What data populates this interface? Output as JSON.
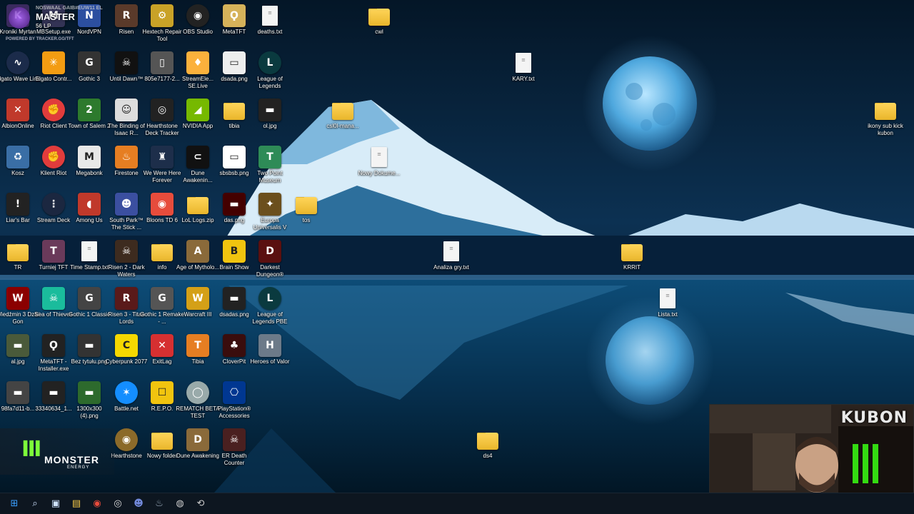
{
  "overlay": {
    "player": "NOSWAAL GAIB#EUW11 EL",
    "rank": "MASTER",
    "lp": "56 LP",
    "powered_by": "POWERED BY TRACKER.GG/TFT"
  },
  "icons": [
    {
      "label": "Kroniki Myrtan",
      "kind": "tile",
      "bg": "#3a2a5e",
      "sym": "K"
    },
    {
      "label": "MBSetup.exe",
      "kind": "tile",
      "bg": "#335",
      "sym": "M"
    },
    {
      "label": "NordVPN",
      "kind": "tile",
      "bg": "#2c4fa0",
      "sym": "N"
    },
    {
      "label": "Risen",
      "kind": "tile",
      "bg": "#5a3a2a",
      "sym": "R"
    },
    {
      "label": "Hextech Repair Tool",
      "kind": "tile",
      "bg": "#c9a227",
      "sym": "⚙"
    },
    {
      "label": "OBS Studio",
      "kind": "round",
      "bg": "#222",
      "sym": "◉"
    },
    {
      "label": "MetaTFT",
      "kind": "tile",
      "bg": "#d6b25a",
      "sym": "Ϙ"
    },
    {
      "label": "deaths.txt",
      "kind": "file",
      "bg": "#f4f4f4",
      "sym": "≡"
    },
    {
      "label": "cwl",
      "kind": "folder",
      "bg": "#ffd55a",
      "sym": ""
    },
    {
      "label": "Elgato Wave Link",
      "kind": "round",
      "bg": "#1b2b4a",
      "sym": "∿"
    },
    {
      "label": "Elgato Contr...",
      "kind": "tile",
      "bg": "#f39c12",
      "sym": "✳"
    },
    {
      "label": "Gothic 3",
      "kind": "tile",
      "bg": "#333",
      "sym": "G"
    },
    {
      "label": "Until Dawn™",
      "kind": "tile",
      "bg": "#111",
      "sym": "☠"
    },
    {
      "label": "805e7177-2...",
      "kind": "tile",
      "bg": "#555",
      "sym": "▯"
    },
    {
      "label": "StreamEle... SE.Live",
      "kind": "tile",
      "bg": "#fbb13c",
      "sym": "♦"
    },
    {
      "label": "dsada.png",
      "kind": "tile",
      "bg": "#eee",
      "sym": "▭"
    },
    {
      "label": "League of Legends",
      "kind": "round",
      "bg": "#0a3a3f",
      "sym": "L"
    },
    {
      "label": "KARY.txt",
      "kind": "file",
      "bg": "#f4f4f4",
      "sym": "≡"
    },
    {
      "label": "AlbionOnline",
      "kind": "tile",
      "bg": "#c0392b",
      "sym": "✕"
    },
    {
      "label": "Riot Client",
      "kind": "round",
      "bg": "#e13c3c",
      "sym": "✊"
    },
    {
      "label": "Town of Salem 2",
      "kind": "tile",
      "bg": "#2d7a2d",
      "sym": "2"
    },
    {
      "label": "The Binding of Isaac R...",
      "kind": "tile",
      "bg": "#ddd",
      "sym": "☺"
    },
    {
      "label": "Hearthstone Deck Tracker",
      "kind": "tile",
      "bg": "#222",
      "sym": "◎"
    },
    {
      "label": "NVIDIA App",
      "kind": "tile",
      "bg": "#76b900",
      "sym": "◢"
    },
    {
      "label": "tibia",
      "kind": "folder",
      "bg": "#ffd55a",
      "sym": ""
    },
    {
      "label": "ol.jpg",
      "kind": "tile",
      "bg": "#222",
      "sym": "▬"
    },
    {
      "label": "csl0l-mana...",
      "kind": "folder",
      "bg": "#ffd55a",
      "sym": ""
    },
    {
      "label": "ikony sub kick kubon",
      "kind": "folder",
      "bg": "#ffd55a",
      "sym": ""
    },
    {
      "label": "Kosz",
      "kind": "tile",
      "bg": "#3a6ea5",
      "sym": "♻"
    },
    {
      "label": "Klient Riot",
      "kind": "round",
      "bg": "#e13c3c",
      "sym": "✊"
    },
    {
      "label": "Megabonk",
      "kind": "tile",
      "bg": "#e8e8e8",
      "sym": "M"
    },
    {
      "label": "Firestone",
      "kind": "tile",
      "bg": "#e67e22",
      "sym": "♨"
    },
    {
      "label": "We Were Here Forever",
      "kind": "tile",
      "bg": "#1d2e4a",
      "sym": "♜"
    },
    {
      "label": "Dune Awakenin...",
      "kind": "tile",
      "bg": "#111",
      "sym": "⊂"
    },
    {
      "label": "sbsbsb.png",
      "kind": "tile",
      "bg": "#fff",
      "sym": "▭"
    },
    {
      "label": "Two Point Museum",
      "kind": "tile",
      "bg": "#2e8b57",
      "sym": "T"
    },
    {
      "label": "Nowy Dokume...",
      "kind": "file",
      "bg": "#f4f4f4",
      "sym": "≡"
    },
    {
      "label": "Liar's Bar",
      "kind": "tile",
      "bg": "#222",
      "sym": "!"
    },
    {
      "label": "Stream Deck",
      "kind": "round",
      "bg": "#1b2740",
      "sym": "⋮"
    },
    {
      "label": "Among Us",
      "kind": "tile",
      "bg": "#c0392b",
      "sym": "◖"
    },
    {
      "label": "South Park™ The Stick ...",
      "kind": "tile",
      "bg": "#3b4fa0",
      "sym": "☻"
    },
    {
      "label": "Bloons TD 6",
      "kind": "tile",
      "bg": "#e74c3c",
      "sym": "◉"
    },
    {
      "label": "LoL Logs.zip",
      "kind": "folder",
      "bg": "#ffd55a",
      "sym": ""
    },
    {
      "label": "das.png",
      "kind": "tile",
      "bg": "#400",
      "sym": "▬"
    },
    {
      "label": "Europa Universalis V",
      "kind": "tile",
      "bg": "#6b4f1d",
      "sym": "✦"
    },
    {
      "label": "tos",
      "kind": "folder",
      "bg": "#ffd55a",
      "sym": ""
    },
    {
      "label": "TR",
      "kind": "folder",
      "bg": "#ffd55a",
      "sym": ""
    },
    {
      "label": "Turniej TFT",
      "kind": "tile",
      "bg": "#6a3a5a",
      "sym": "T"
    },
    {
      "label": "Time Stamp.txt",
      "kind": "file",
      "bg": "#f4f4f4",
      "sym": "≡"
    },
    {
      "label": "Risen 2 - Dark Waters",
      "kind": "tile",
      "bg": "#3d2b1f",
      "sym": "☠"
    },
    {
      "label": "info",
      "kind": "folder",
      "bg": "#ffd55a",
      "sym": ""
    },
    {
      "label": "Age of Mytholo...",
      "kind": "tile",
      "bg": "#8a6a3a",
      "sym": "A"
    },
    {
      "label": "Brain Show",
      "kind": "tile",
      "bg": "#f1c40f",
      "sym": "B"
    },
    {
      "label": "Darkest Dungeon®",
      "kind": "tile",
      "bg": "#5a1010",
      "sym": "D"
    },
    {
      "label": "Analiza gry.txt",
      "kind": "file",
      "bg": "#f4f4f4",
      "sym": "≡"
    },
    {
      "label": "KRRIT",
      "kind": "folder",
      "bg": "#ffd55a",
      "sym": ""
    },
    {
      "label": "Wiedźmin 3 Dziki Gon",
      "kind": "tile",
      "bg": "#8b0000",
      "sym": "W"
    },
    {
      "label": "Sea of Thieves",
      "kind": "tile",
      "bg": "#1abc9c",
      "sym": "☠"
    },
    {
      "label": "Gothic 1 Classic",
      "kind": "tile",
      "bg": "#444",
      "sym": "G"
    },
    {
      "label": "Risen 3 - Titan Lords",
      "kind": "tile",
      "bg": "#5a1a1a",
      "sym": "R"
    },
    {
      "label": "Gothic 1 Remake - ...",
      "kind": "tile",
      "bg": "#555",
      "sym": "G"
    },
    {
      "label": "Warcraft III",
      "kind": "tile",
      "bg": "#d4a017",
      "sym": "W"
    },
    {
      "label": "dsadas.png",
      "kind": "tile",
      "bg": "#222",
      "sym": "▬"
    },
    {
      "label": "League of Legends PBE",
      "kind": "round",
      "bg": "#0a3a3f",
      "sym": "L"
    },
    {
      "label": "Lista.txt",
      "kind": "file",
      "bg": "#f4f4f4",
      "sym": "≡"
    },
    {
      "label": "al.jpg",
      "kind": "tile",
      "bg": "#4a5a3a",
      "sym": "▬"
    },
    {
      "label": "MetaTFT - Installer.exe",
      "kind": "tile",
      "bg": "#222",
      "sym": "Ϙ"
    },
    {
      "label": "Bez tytułu.png",
      "kind": "tile",
      "bg": "#333",
      "sym": "▬"
    },
    {
      "label": "Cyberpunk 2077",
      "kind": "tile",
      "bg": "#f5d800",
      "sym": "C"
    },
    {
      "label": "ExitLag",
      "kind": "tile",
      "bg": "#d63031",
      "sym": "✕"
    },
    {
      "label": "Tibia",
      "kind": "tile",
      "bg": "#e67e22",
      "sym": "T"
    },
    {
      "label": "CloverPit",
      "kind": "tile",
      "bg": "#3a0d0d",
      "sym": "♣"
    },
    {
      "label": "Heroes of Valor",
      "kind": "tile",
      "bg": "#6c7a89",
      "sym": "H"
    },
    {
      "label": "98fa7d11-b...",
      "kind": "tile",
      "bg": "#444",
      "sym": "▬"
    },
    {
      "label": "33340634_1...",
      "kind": "tile",
      "bg": "#222",
      "sym": "▬"
    },
    {
      "label": "1300x300 (4).png",
      "kind": "tile",
      "bg": "#2d6a2d",
      "sym": "▬"
    },
    {
      "label": "Battle.net",
      "kind": "round",
      "bg": "#148eff",
      "sym": "✶"
    },
    {
      "label": "R.E.P.O.",
      "kind": "tile",
      "bg": "#f1c40f",
      "sym": "☐"
    },
    {
      "label": "REMATCH BETA TEST",
      "kind": "round",
      "bg": "#9aa",
      "sym": "◯"
    },
    {
      "label": "PlayStation® Accessories",
      "kind": "tile",
      "bg": "#003791",
      "sym": "⎔"
    },
    {
      "label": "Hearthstone",
      "kind": "round",
      "bg": "#8b6a2a",
      "sym": "◉"
    },
    {
      "label": "Nowy folder",
      "kind": "folder",
      "bg": "#ffd55a",
      "sym": ""
    },
    {
      "label": "Dune Awakening",
      "kind": "tile",
      "bg": "#8a6a3a",
      "sym": "D"
    },
    {
      "label": "ER Death Counter",
      "kind": "tile",
      "bg": "#4a2020",
      "sym": "☠"
    },
    {
      "label": "ds4",
      "kind": "folder",
      "bg": "#ffd55a",
      "sym": ""
    }
  ],
  "taskbar": [
    {
      "name": "start-button",
      "sym": "⊞",
      "color": "#3aa0ff"
    },
    {
      "name": "search-icon",
      "sym": "⌕",
      "color": "#cfe3ff"
    },
    {
      "name": "task-view-icon",
      "sym": "▣",
      "color": "#cfe3ff"
    },
    {
      "name": "file-explorer-icon",
      "sym": "▤",
      "color": "#f7c948"
    },
    {
      "name": "chrome-icon",
      "sym": "◉",
      "color": "#e94b3c"
    },
    {
      "name": "obs-taskbar-icon",
      "sym": "◎",
      "color": "#ddd"
    },
    {
      "name": "discord-icon",
      "sym": "☻",
      "color": "#7289da"
    },
    {
      "name": "steam-icon",
      "sym": "♨",
      "color": "#9ab"
    },
    {
      "name": "obs-studio-taskbar-icon",
      "sym": "◍",
      "color": "#ccc"
    },
    {
      "name": "app-taskbar-icon",
      "sym": "⟲",
      "color": "#ccc"
    }
  ],
  "sponsor": {
    "brand": "MONSTER",
    "sub": "ENERGY"
  },
  "webcam": {
    "name": "KUBON"
  }
}
